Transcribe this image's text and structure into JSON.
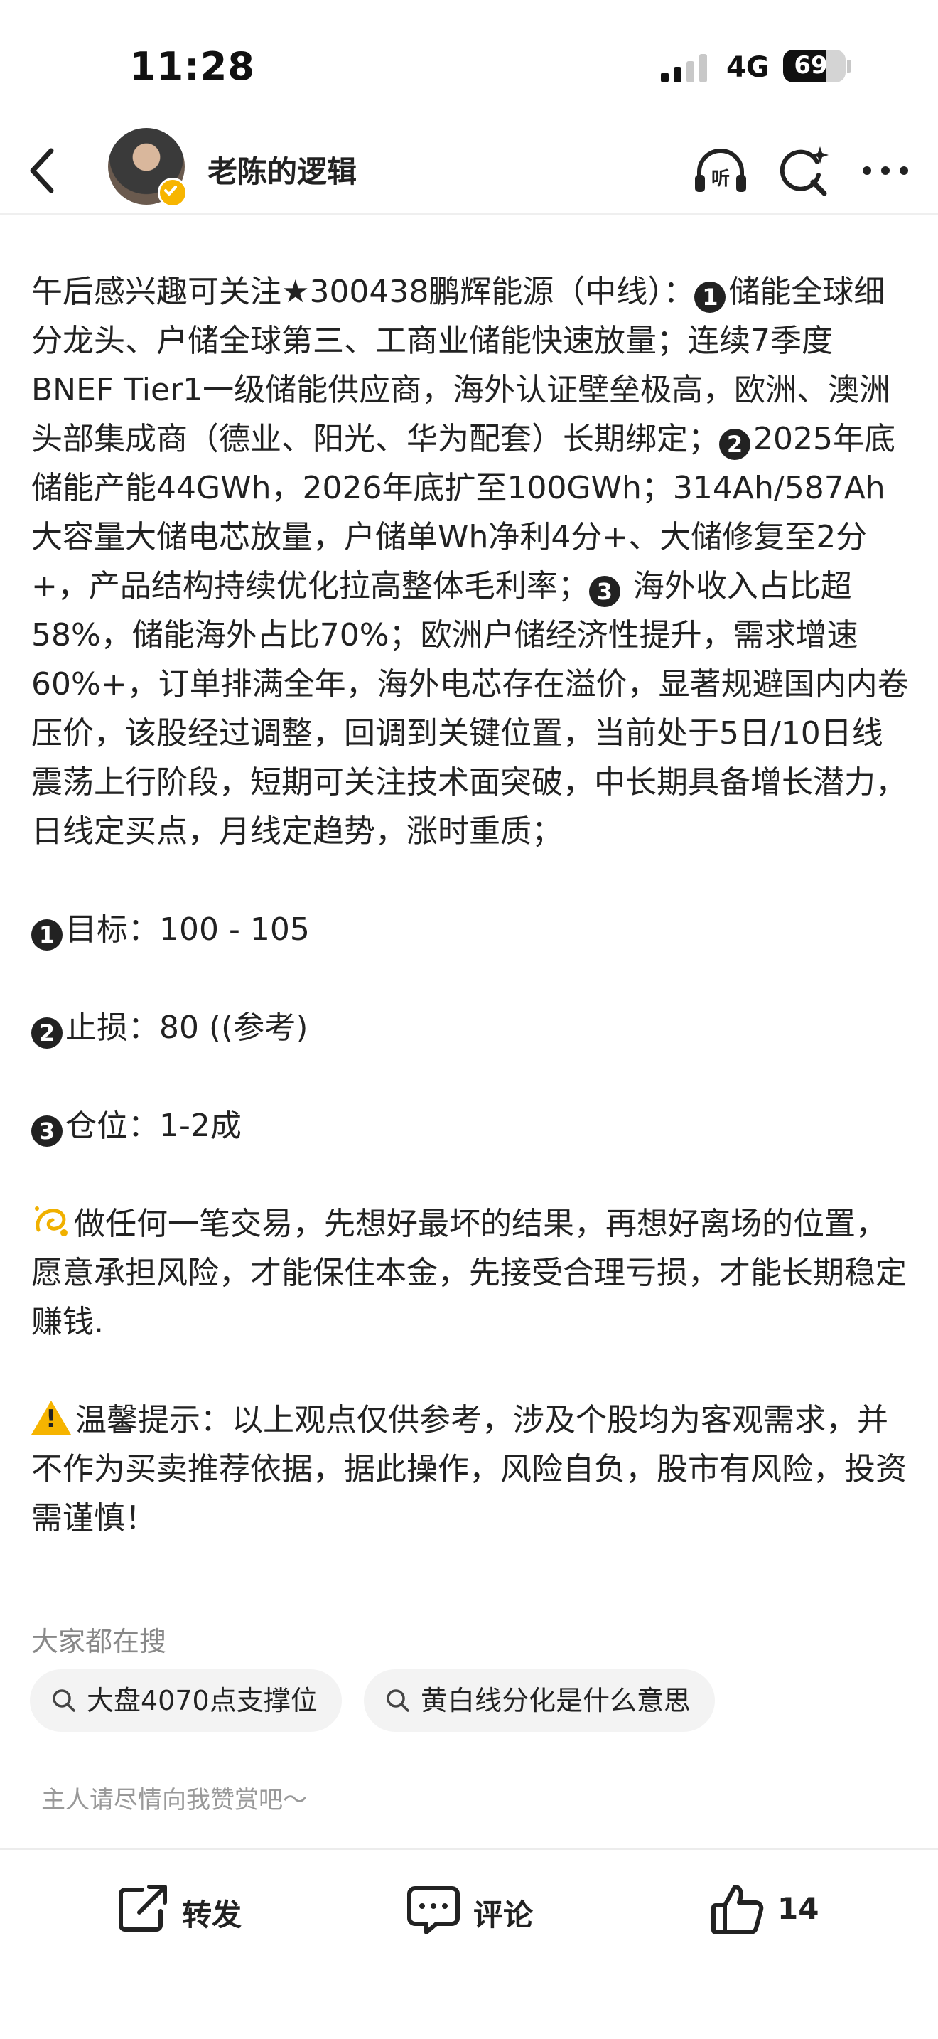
{
  "status_bar": {
    "time": "11:28",
    "network": "4G",
    "battery": "69",
    "battery_level": 0.69
  },
  "nav": {
    "author": "老陈的逻辑",
    "icons": [
      "back-icon",
      "listen-icon",
      "search-spark-icon",
      "more-icon"
    ]
  },
  "post": {
    "paragraph1_pre": "午后感兴趣可关注★300438鹏辉能源（中线）：",
    "n1": "1",
    "paragraph1_a": "储能全球细分龙头、户储全球第三、工商业储能快速放量；连续7季度BNEF Tier1一级储能供应商，海外认证壁垒极高，欧洲、澳洲头部集成商（德业、阳光、华为配套）长期绑定；",
    "n2": "2",
    "paragraph1_b": "2025年底储能产能44GWh，2026年底扩至100GWh；314Ah/587Ah大容量大储电芯放量，户储单Wh净利4分+、大储修复至2分+，产品结构持续优化拉高整体毛利率；",
    "n3": "3",
    "paragraph1_c": " 海外收入占比超58%，储能海外占比70%；欧洲户储经济性提升，需求增速60%+，订单排满全年，海外电芯存在溢价，显著规避国内内卷压价，该股经过调整，回调到关键位置，当前处于5日/10日线震荡上行阶段，短期可关注技术面突破，中长期具备增长潜力，日线定买点，月线定趋势，涨时重质；",
    "target": "目标：100 - 105",
    "stop": "止损：80 ((参考)",
    "position": "仓位：1-2成",
    "advice": "做任何一笔交易，先想好最坏的结果，再想好离场的位置，愿意承担风险，才能保住本金，先接受合理亏损，才能长期稳定赚钱.",
    "warning": "温馨提示：以上观点仅供参考，涉及个股均为客观需求，并不作为买卖推荐依据，据此操作，风险自负，股市有风险，投资需谨慎！"
  },
  "search": {
    "title": "大家都在搜",
    "chips": [
      "大盘4070点支撑位",
      "黄白线分化是什么意思"
    ]
  },
  "reward_text": "主人请尽情向我赞赏吧～",
  "actions": {
    "share": "转发",
    "comment": "评论",
    "like_count": "14"
  },
  "colors": {
    "accent_verified": "#f7b500",
    "warning": "#f6b400"
  }
}
